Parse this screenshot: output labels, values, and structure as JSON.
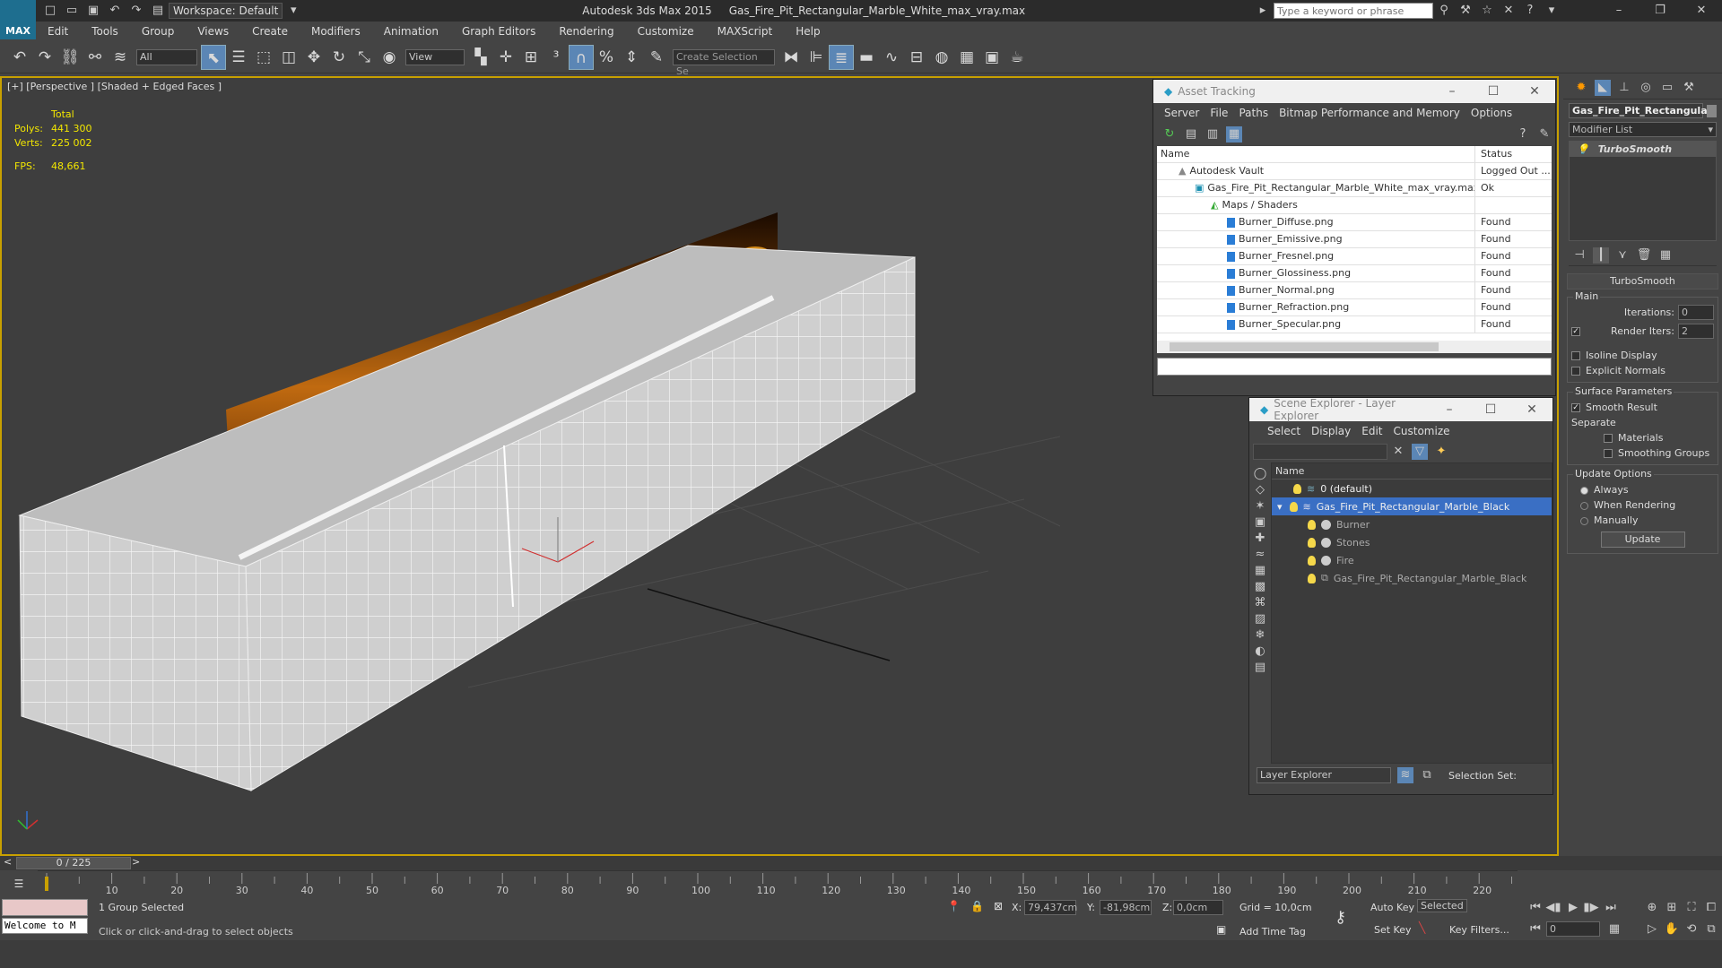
{
  "window": {
    "app_title": "Autodesk 3ds Max  2015",
    "file_title": "Gas_Fire_Pit_Rectangular_Marble_White_max_vray.max",
    "workspace": "Workspace: Default",
    "search_placeholder": "Type a keyword or phrase",
    "logo": "MAX"
  },
  "menu": [
    "Edit",
    "Tools",
    "Group",
    "Views",
    "Create",
    "Modifiers",
    "Animation",
    "Graph Editors",
    "Rendering",
    "Customize",
    "MAXScript",
    "Help"
  ],
  "toolbar": {
    "filter": "All",
    "ref_coord": "View",
    "selection_set_placeholder": "Create Selection Se"
  },
  "viewport": {
    "label": "[+] [Perspective ] [Shaded + Edged Faces ]",
    "stats_header": "Total",
    "polys_label": "Polys:",
    "polys": "441 300",
    "verts_label": "Verts:",
    "verts": "225 002",
    "fps_label": "FPS:",
    "fps": "48,661"
  },
  "asset_tracking": {
    "title": "Asset Tracking",
    "menu": [
      "Server",
      "File",
      "Paths",
      "Bitmap Performance and Memory",
      "Options"
    ],
    "col_name": "Name",
    "col_status": "Status",
    "rows": [
      {
        "name": "Autodesk Vault",
        "status": "Logged Out ...",
        "indent": 1
      },
      {
        "name": "Gas_Fire_Pit_Rectangular_Marble_White_max_vray.max",
        "status": "Ok",
        "indent": 2
      },
      {
        "name": "Maps / Shaders",
        "status": "",
        "indent": 3
      },
      {
        "name": "Burner_Diffuse.png",
        "status": "Found",
        "indent": 4
      },
      {
        "name": "Burner_Emissive.png",
        "status": "Found",
        "indent": 4
      },
      {
        "name": "Burner_Fresnel.png",
        "status": "Found",
        "indent": 4
      },
      {
        "name": "Burner_Glossiness.png",
        "status": "Found",
        "indent": 4
      },
      {
        "name": "Burner_Normal.png",
        "status": "Found",
        "indent": 4
      },
      {
        "name": "Burner_Refraction.png",
        "status": "Found",
        "indent": 4
      },
      {
        "name": "Burner_Specular.png",
        "status": "Found",
        "indent": 4
      }
    ]
  },
  "layer_explorer": {
    "title": "Scene Explorer - Layer Explorer",
    "menu": [
      "Select",
      "Display",
      "Edit",
      "Customize"
    ],
    "col_name": "Name",
    "rows": [
      {
        "name": "0 (default)",
        "indent": 0,
        "selected": false,
        "dim": false
      },
      {
        "name": "Gas_Fire_Pit_Rectangular_Marble_Black",
        "indent": 0,
        "selected": true,
        "dim": false
      },
      {
        "name": "Burner",
        "indent": 1,
        "selected": false,
        "dim": true
      },
      {
        "name": "Stones",
        "indent": 1,
        "selected": false,
        "dim": true
      },
      {
        "name": "Fire",
        "indent": 1,
        "selected": false,
        "dim": true
      },
      {
        "name": "Gas_Fire_Pit_Rectangular_Marble_Black",
        "indent": 1,
        "selected": false,
        "dim": true
      }
    ],
    "footer_dropdown": "Layer Explorer",
    "selection_set_label": "Selection Set:"
  },
  "command_panel": {
    "object_name": "Gas_Fire_Pit_Rectangula",
    "modifier_list": "Modifier List",
    "stack_item": "TurboSmooth",
    "rollout": "TurboSmooth",
    "main_group": "Main",
    "iterations_label": "Iterations:",
    "iterations": "0",
    "render_iters_label": "Render Iters:",
    "render_iters": "2",
    "isoline": "Isoline Display",
    "explicit_normals": "Explicit Normals",
    "surface_group": "Surface Parameters",
    "smooth_result": "Smooth Result",
    "separate": "Separate",
    "materials": "Materials",
    "smoothing_groups": "Smoothing Groups",
    "update_group": "Update Options",
    "always": "Always",
    "when_rendering": "When Rendering",
    "manually": "Manually",
    "update_button": "Update"
  },
  "timeline": {
    "frame": "0 / 225",
    "ticks": [
      "10",
      "20",
      "30",
      "40",
      "50",
      "60",
      "70",
      "80",
      "90",
      "100",
      "110",
      "120",
      "130",
      "140",
      "150",
      "160",
      "170",
      "180",
      "190",
      "200",
      "210",
      "220"
    ]
  },
  "status": {
    "script": "Welcome to M",
    "selection": "1 Group Selected",
    "prompt": "Click or click-and-drag to select objects",
    "x_label": "X:",
    "x": "79,437cm",
    "y_label": "Y:",
    "y": "-81,98cm",
    "z_label": "Z:",
    "z": "0,0cm",
    "grid": "Grid = 10,0cm",
    "add_time_tag": "Add Time Tag",
    "auto_key": "Auto Key",
    "selected": "Selected",
    "set_key": "Set Key",
    "key_filters": "Key Filters...",
    "frame_field": "0"
  }
}
